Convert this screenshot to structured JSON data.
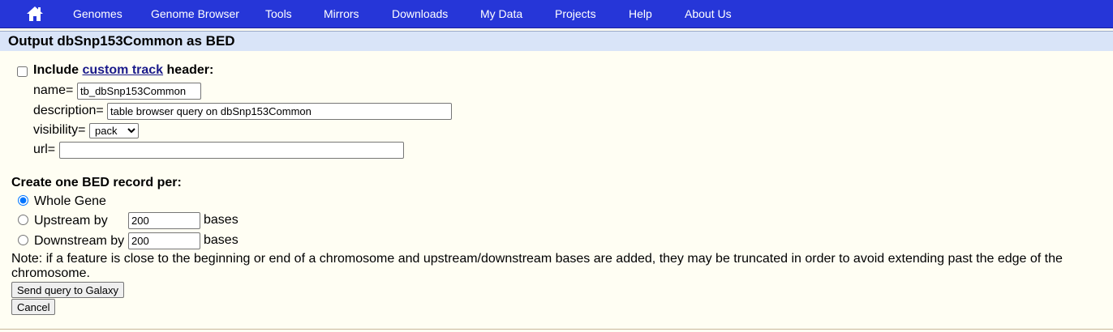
{
  "nav": {
    "home_icon": "home-icon",
    "items": [
      "Genomes",
      "Genome Browser",
      "Tools",
      "Mirrors",
      "Downloads",
      "My Data",
      "Projects",
      "Help",
      "About Us"
    ]
  },
  "page_title": "Output dbSnp153Common as BED",
  "custom_track": {
    "include_prefix": "Include",
    "link_text": "custom track",
    "include_suffix": "header:",
    "checked": false,
    "name_label": "name=",
    "name_value": "tb_dbSnp153Common",
    "description_label": "description=",
    "description_value": "table browser query on dbSnp153Common",
    "visibility_label": "visibility=",
    "visibility_value": "pack",
    "url_label": "url=",
    "url_value": ""
  },
  "bed_record": {
    "heading": "Create one BED record per:",
    "selected": "Whole Gene",
    "whole_gene_label": "Whole Gene",
    "upstream_label": "Upstream by",
    "upstream_value": "200",
    "downstream_label": "Downstream by",
    "downstream_value": "200",
    "bases_label": "bases"
  },
  "note": "Note: if a feature is close to the beginning or end of a chromosome and upstream/downstream bases are added, they may be truncated in order to avoid extending past the edge of the chromosome.",
  "buttons": {
    "galaxy": "Send query to Galaxy",
    "cancel": "Cancel"
  },
  "colors": {
    "navbar": "#2636d8",
    "title_bar": "#d9e4f8",
    "page_bg": "#fffef3",
    "link": "#1a1a8a"
  }
}
